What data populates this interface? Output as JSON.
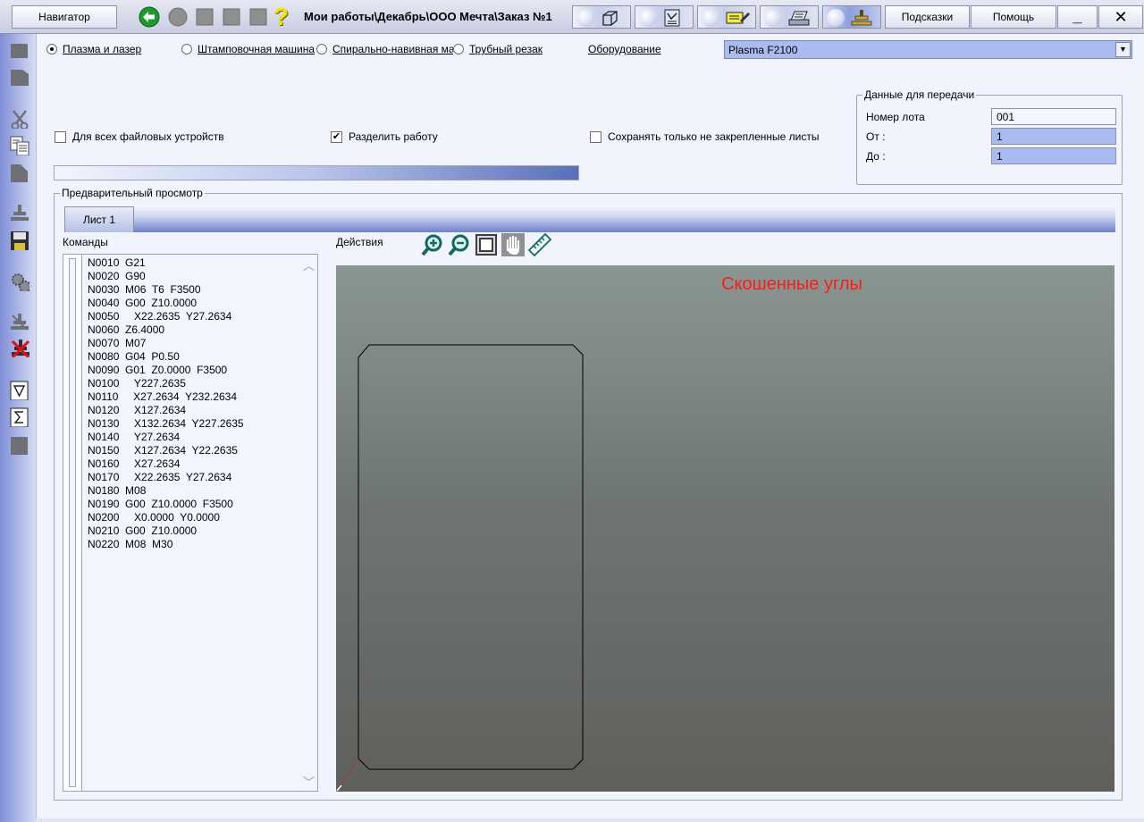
{
  "toolbar": {
    "navigator_label": "Навигатор",
    "path_title": "Мои работы\\Декабрь\\ООО Мечта\\Заказ №1",
    "hints_label": "Подсказки",
    "help_label": "Помощь",
    "minimize_glyph": "_",
    "close_glyph": "✕",
    "help_icon_glyph": "?"
  },
  "machine_types": {
    "items": [
      {
        "label": "Плазма и лазер",
        "selected": true
      },
      {
        "label": "Штамповочная машина",
        "selected": false
      },
      {
        "label": "Спирально-навивная машина",
        "selected": false
      },
      {
        "label": "Трубный резак",
        "selected": false
      }
    ]
  },
  "equipment": {
    "label": "Оборудование",
    "value": "Plasma F2100",
    "arrow": "▼"
  },
  "options": {
    "all_file_devices": {
      "label": "Для всех файловых устройств",
      "checked": false,
      "mark": ""
    },
    "split_job": {
      "label": "Разделить работу",
      "checked": true,
      "mark": "✔"
    },
    "save_unfixed": {
      "label": "Сохранять только не закрепленные листы",
      "checked": false,
      "mark": ""
    }
  },
  "transfer": {
    "title": "Данные для передачи",
    "lot_label": "Номер лота",
    "lot_value": "001",
    "from_label": "От :",
    "from_value": "1",
    "to_label": "До :",
    "to_value": "1"
  },
  "preview": {
    "title": "Предварительный просмотр",
    "tab_label": "Лист 1",
    "commands_label": "Команды",
    "actions_label": "Действия",
    "canvas_title": "Скошенные углы",
    "scroll_up": "︿",
    "scroll_down": "﹀"
  },
  "commands": [
    "N0010  G21",
    "N0020  G90",
    "N0030  M06  T6  F3500",
    "N0040  G00  Z10.0000",
    "N0050     X22.2635  Y27.2634",
    "N0060  Z6.4000",
    "N0070  M07",
    "N0080  G04  P0.50",
    "N0090  G01  Z0.0000  F3500",
    "N0100     Y227.2635",
    "N0110     X27.2634  Y232.2634",
    "N0120     X127.2634",
    "N0130     X132.2634  Y227.2635",
    "N0140     Y27.2634",
    "N0150     X127.2634  Y22.2635",
    "N0160     X27.2634",
    "N0170     X22.2635  Y27.2634",
    "N0180  M08",
    "N0190  G00  Z10.0000  F3500",
    "N0200     X0.0000  Y0.0000",
    "N0210  G00  Z10.0000",
    "N0220  M08  M30"
  ],
  "colors": {
    "accent_blue": "#5a6fb8",
    "field_blue": "#a9bbef",
    "canvas_title_red": "#ff1a1a",
    "toolpath_black": "#000000"
  }
}
